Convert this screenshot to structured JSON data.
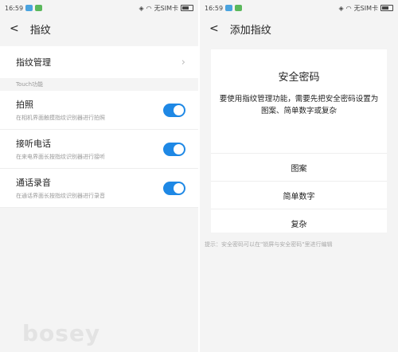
{
  "left": {
    "status": {
      "time": "16:59",
      "carrier": "无SIM卡"
    },
    "title": "指纹",
    "manage_label": "指纹管理",
    "section_label": "Touch功能",
    "settings": [
      {
        "title": "拍照",
        "subtitle": "在相机界面触摸指纹识别器进行拍照",
        "enabled": true
      },
      {
        "title": "接听电话",
        "subtitle": "在来电界面长按指纹识别器进行接听",
        "enabled": true
      },
      {
        "title": "通话录音",
        "subtitle": "在通话界面长按指纹识别器进行录音",
        "enabled": true
      }
    ],
    "watermark": "bosey"
  },
  "right": {
    "status": {
      "time": "16:59",
      "carrier": "无SIM卡"
    },
    "title": "添加指纹",
    "password_title": "安全密码",
    "password_desc": "要使用指纹管理功能，需要先把安全密码设置为图案、简单数字或复杂",
    "options": [
      "图案",
      "简单数字",
      "复杂"
    ],
    "tip": "提示：安全密码可以在\"锁屏与安全密码\"里进行编辑"
  },
  "colors": {
    "toggle_on": "#1e88e5",
    "background": "#f4f4f4"
  }
}
